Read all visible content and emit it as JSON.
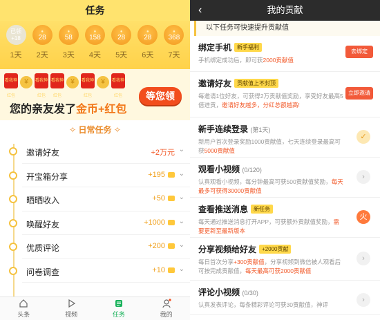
{
  "left": {
    "title": "任务",
    "checkin": [
      {
        "amount": "已领",
        "bonus": "+18",
        "label": "1天",
        "done": true
      },
      {
        "amount": "28",
        "label": "2天"
      },
      {
        "amount": "58",
        "label": "3天"
      },
      {
        "amount": "158",
        "label": "4天"
      },
      {
        "amount": "28",
        "label": "5天"
      },
      {
        "amount": "28",
        "label": "6天"
      },
      {
        "amount": "368",
        "label": "7天"
      }
    ],
    "banner": {
      "bag_text": "看我神红包",
      "msg_prefix": "您的亲友发了",
      "msg_highlight": "金币+红包",
      "button": "等您领"
    },
    "section_title": "日常任务",
    "tasks": [
      {
        "name": "邀请好友",
        "reward": "+2万元",
        "style": "red"
      },
      {
        "name": "开宝箱分享",
        "reward": "+195",
        "style": "gold"
      },
      {
        "name": "晒晒收入",
        "reward": "+50",
        "style": "gold"
      },
      {
        "name": "唤醒好友",
        "reward": "+1000",
        "style": "gold"
      },
      {
        "name": "优质评论",
        "reward": "+200",
        "style": "gold"
      },
      {
        "name": "问卷调查",
        "reward": "+10",
        "style": "gold"
      }
    ],
    "tabs": [
      {
        "label": "头条",
        "icon": "home-icon"
      },
      {
        "label": "视频",
        "icon": "play-icon"
      },
      {
        "label": "任务",
        "icon": "task-icon",
        "active": true
      },
      {
        "label": "我的",
        "icon": "profile-icon"
      }
    ]
  },
  "right": {
    "title": "我的贡献",
    "sub_head": "以下任务可快速提升贡献值",
    "items": [
      {
        "title": "绑定手机",
        "tag": "新手福利",
        "desc_plain": "手机绑定成功后，即可获",
        "desc_hl": "2000贡献值",
        "desc_tail": "",
        "action": "去绑定"
      },
      {
        "title": "邀请好友",
        "tag": "贡献值上不封顶",
        "desc_plain": "每邀请1位好友，可获得2万贡献值奖励，享受好友最高5倍进贡，",
        "desc_hl": "邀请好友越多，分红总额越高!",
        "desc_tail": "",
        "action": "立即邀请"
      },
      {
        "title": "新手连续登录",
        "light": "(第1天)",
        "desc_plain": "新用户首次登录奖励1000贡献值，七天连续登录最高可获",
        "desc_hl": "5000贡献值",
        "desc_tail": "",
        "state": "✓"
      },
      {
        "title": "观看小视频",
        "light": "(0/120)",
        "desc_plain": "认真观看小视频，每分钟最高可获500贡献值奖励，",
        "desc_hl": "每天最多可获得30000贡献值",
        "desc_tail": "",
        "state": "›"
      },
      {
        "title": "查看推送消息",
        "tag": "新任务",
        "desc_plain": "每天通过推送消息打开APP，可获额外贡献值奖励，",
        "desc_hl": "需要更新至最新版本",
        "desc_tail": "",
        "state": "火"
      },
      {
        "title": "分享视频给好友",
        "tag": "+2000贡献",
        "desc_plain": "每日首次分享",
        "desc_hl": "+300贡献值",
        "desc_tail": "，分享视频到微信被人观看后可按完成贡献值，",
        "desc_hl2": "每天最高可获2000贡献值",
        "state": "›"
      },
      {
        "title": "评论小视频",
        "light": "(0/30)",
        "desc_plain": "认真发表评论，每条精彩评论可获30贡献值，神评",
        "desc_hl": "",
        "desc_tail": "",
        "state": "›"
      }
    ]
  }
}
